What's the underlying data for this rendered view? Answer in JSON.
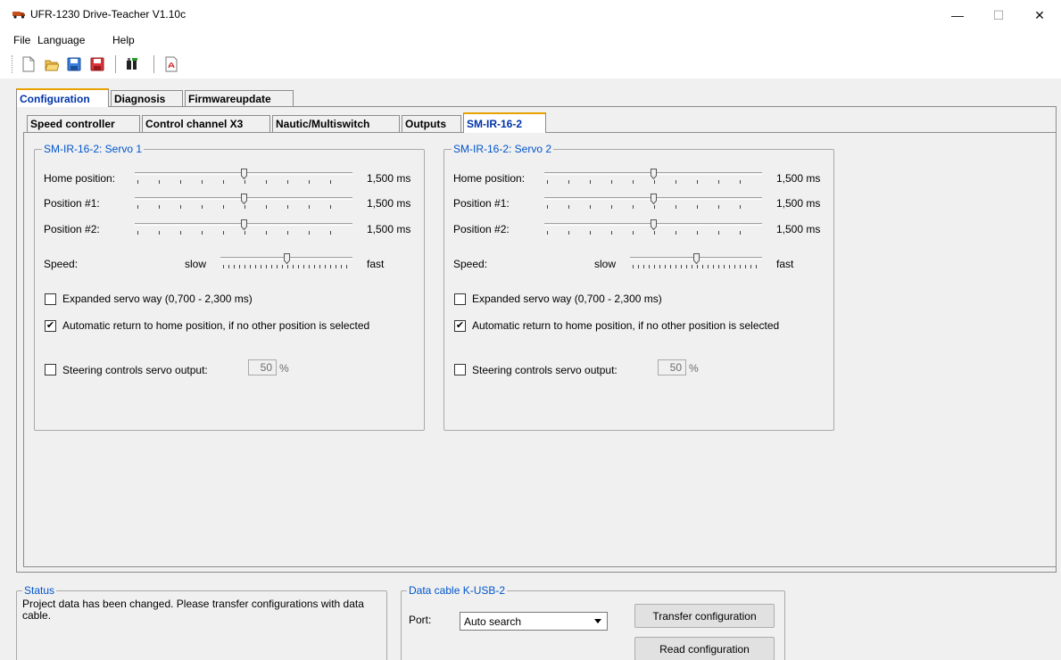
{
  "window": {
    "title": "UFR-1230 Drive-Teacher V1.10c",
    "minimize": "—",
    "maximize": "☐",
    "close": "✕"
  },
  "menu": [
    "File",
    "Language",
    "Help"
  ],
  "toolbar": {
    "icons": [
      "new-file-icon",
      "open-folder-icon",
      "save-icon",
      "save-as-icon",
      "connect-icon",
      "pdf-icon"
    ]
  },
  "main_tabs": [
    {
      "label": "Configuration",
      "active": true
    },
    {
      "label": "Diagnosis",
      "active": false
    },
    {
      "label": "Firmwareupdate",
      "active": false
    }
  ],
  "sub_tabs": [
    {
      "label": "Speed controller",
      "active": false
    },
    {
      "label": "Control channel X3",
      "active": false
    },
    {
      "label": "Nautic/Multiswitch",
      "active": false
    },
    {
      "label": "Outputs",
      "active": false
    },
    {
      "label": "SM-IR-16-2",
      "active": true
    }
  ],
  "servo_groups": [
    {
      "title": "SM-IR-16-2: Servo 1",
      "rows": [
        {
          "label": "Home position:",
          "value": "1,500 ms",
          "level": 0.5
        },
        {
          "label": "Position #1:",
          "value": "1,500 ms",
          "level": 0.5
        },
        {
          "label": "Position #2:",
          "value": "1,500 ms",
          "level": 0.5
        }
      ],
      "speed": {
        "label": "Speed:",
        "min": "slow",
        "max": "fast",
        "level": 0.5
      },
      "expanded": {
        "label": "Expanded servo way (0,700 - 2,300 ms)",
        "checked": false
      },
      "auto_return": {
        "label": "Automatic return to home position, if no other position is selected",
        "checked": true
      },
      "steering": {
        "label": "Steering controls servo output:",
        "checked": false,
        "value": "50",
        "unit": "%"
      }
    },
    {
      "title": "SM-IR-16-2: Servo 2",
      "rows": [
        {
          "label": "Home position:",
          "value": "1,500 ms",
          "level": 0.5
        },
        {
          "label": "Position #1:",
          "value": "1,500 ms",
          "level": 0.5
        },
        {
          "label": "Position #2:",
          "value": "1,500 ms",
          "level": 0.5
        }
      ],
      "speed": {
        "label": "Speed:",
        "min": "slow",
        "max": "fast",
        "level": 0.5
      },
      "expanded": {
        "label": "Expanded servo way (0,700 - 2,300 ms)",
        "checked": false
      },
      "auto_return": {
        "label": "Automatic return to home position, if no other position is selected",
        "checked": true
      },
      "steering": {
        "label": "Steering controls servo output:",
        "checked": false,
        "value": "50",
        "unit": "%"
      }
    }
  ],
  "status": {
    "title": "Status",
    "text": "Project data has been changed. Please transfer configurations with data cable."
  },
  "data_cable": {
    "title": "Data cable K-USB-2",
    "port_label": "Port:",
    "port_value": "Auto search",
    "transfer_button": "Transfer configuration",
    "read_button": "Read configuration"
  },
  "colors": {
    "group_title": "#0055cc",
    "active_tab_text": "#0033aa",
    "active_tab_accent": "#e8a200"
  }
}
